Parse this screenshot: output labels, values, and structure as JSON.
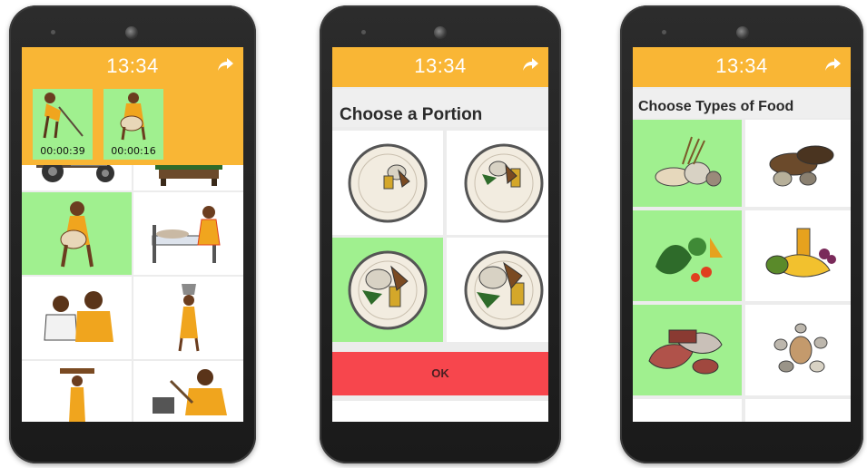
{
  "status": {
    "time": "13:34"
  },
  "phone1": {
    "timers": [
      {
        "label": "00:00:39",
        "icon": "farmer-hoeing-icon"
      },
      {
        "label": "00:00:16",
        "icon": "woman-carrying-baby-icon"
      }
    ],
    "activities": [
      "tractor",
      "table",
      "carrying-baby",
      "caring-for-sick",
      "talking-together",
      "carrying-water",
      "carrying-firewood",
      "cooking"
    ]
  },
  "phone2": {
    "title": "Choose a Portion",
    "ok_label": "OK",
    "portions": [
      "small-portion",
      "medium-portion",
      "large-portion",
      "extra-large-portion"
    ],
    "selected_index": 2
  },
  "phone3": {
    "title": "Choose Types of Food",
    "food_types": [
      "grains-and-bread",
      "roots-and-tubers",
      "vegetables",
      "fruits-and-juice",
      "meat-and-fish",
      "eggs-and-nuts"
    ],
    "selected": [
      0,
      2,
      4
    ]
  },
  "colors": {
    "accent": "#f9b635",
    "selected": "#a0f08f",
    "ok": "#f7464d"
  }
}
